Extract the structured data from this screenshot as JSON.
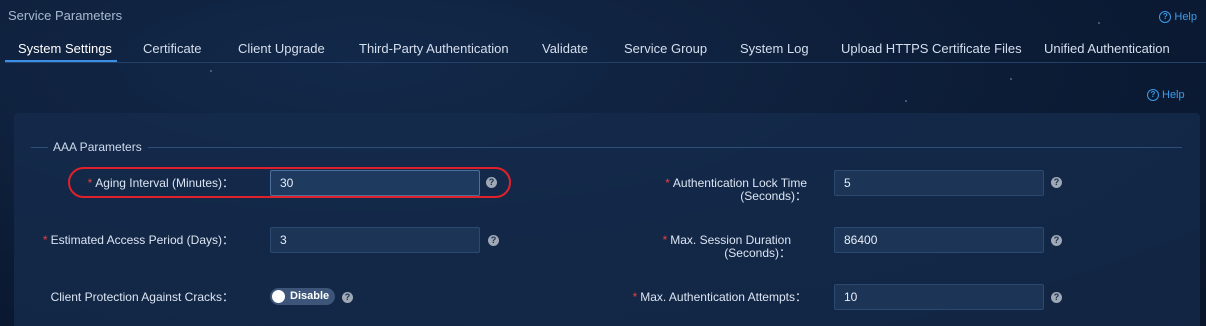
{
  "page": {
    "title": "Service Parameters",
    "help_label": "Help"
  },
  "tabs": [
    {
      "label": "System Settings",
      "active": true
    },
    {
      "label": "Certificate"
    },
    {
      "label": "Client Upgrade"
    },
    {
      "label": "Third-Party Authentication"
    },
    {
      "label": "Validate"
    },
    {
      "label": "Service Group"
    },
    {
      "label": "System Log"
    },
    {
      "label": "Upload HTTPS Certificate Files"
    },
    {
      "label": "Unified Authentication"
    }
  ],
  "panel": {
    "help_label": "Help",
    "section_title": "AAA Parameters",
    "fields": {
      "aging_interval": {
        "label": "Aging Interval (Minutes)：",
        "required": "*",
        "value": "30"
      },
      "estimated_access_period": {
        "label": "Estimated Access Period (Days)：",
        "required": "*",
        "value": "3"
      },
      "client_protection": {
        "label": "Client Protection Against Cracks：",
        "toggle_label": "Disable"
      },
      "auth_lock_time": {
        "label_line1": "Authentication Lock Time",
        "label_line2": "(Seconds)：",
        "required": "*",
        "value": "5"
      },
      "max_session_duration": {
        "label_line1": "Max. Session Duration",
        "label_line2": "(Seconds)：",
        "required": "*",
        "value": "86400"
      },
      "max_auth_attempts": {
        "label": "Max. Authentication Attempts：",
        "required": "*",
        "value": "10"
      }
    }
  },
  "icons": {
    "help": "help-circle-icon",
    "info": "question-mark-icon"
  },
  "colors": {
    "accent": "#3b8fe5",
    "required": "#e2423e",
    "highlight": "#e0202a"
  }
}
